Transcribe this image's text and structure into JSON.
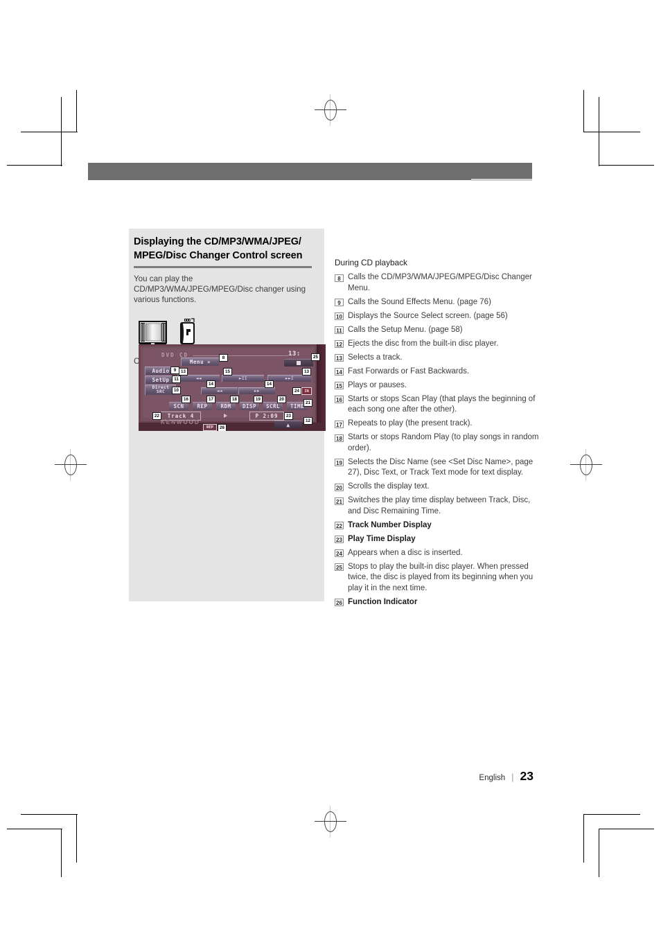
{
  "document": {
    "language": "English",
    "page_number": "23"
  },
  "section": {
    "title": "Displaying the CD/MP3/WMA/JPEG/ MPEG/Disc Changer Control screen",
    "intro": "You can play the CD/MP3/WMA/JPEG/MPEG/Disc changer using various functions.",
    "screen_label": "CD Control screen",
    "icons": [
      {
        "name": "monitor-icon",
        "meaning": "monitor screen"
      },
      {
        "name": "remote-control-icon",
        "meaning": "remote control"
      }
    ]
  },
  "cd_control_screen": {
    "source_label": "DVD CD",
    "clock": "13:",
    "menu_button": "Menu »",
    "left_buttons": [
      "Audio",
      "SetUp",
      "Direct SRC"
    ],
    "transport": {
      "track_prev": "◄◄",
      "play_pause": "►II",
      "track_next": "►►I",
      "fast_back": "◄◄",
      "fast_fwd": "►►"
    },
    "function_buttons": [
      "SCN",
      "REP",
      "RDM",
      "DISP",
      "SCRL",
      "TIME"
    ],
    "track_display": "Track 4",
    "disc_text": "KENWOOD",
    "play_time": "P 2:09",
    "in_badge": "IN",
    "function_indicator": "REP",
    "eject_symbol": "▲",
    "callouts": [
      "8",
      "9",
      "10",
      "11",
      "12",
      "13",
      "13",
      "14",
      "14",
      "15",
      "16",
      "17",
      "18",
      "19",
      "20",
      "21",
      "22",
      "23",
      "24",
      "25",
      "26"
    ]
  },
  "right_column": {
    "heading": "During CD playback",
    "items": [
      {
        "num": "8",
        "text": "Calls the CD/MP3/WMA/JPEG/MPEG/Disc Changer Menu.",
        "bold": false
      },
      {
        "num": "9",
        "text": "Calls the Sound Effects Menu. (page 76)",
        "bold": false
      },
      {
        "num": "10",
        "text": "Displays the Source Select screen. (page 56)",
        "bold": false
      },
      {
        "num": "11",
        "text": "Calls the Setup Menu. (page 58)",
        "bold": false
      },
      {
        "num": "12",
        "text": "Ejects the disc from the built-in disc player.",
        "bold": false
      },
      {
        "num": "13",
        "text": "Selects a track.",
        "bold": false
      },
      {
        "num": "14",
        "text": "Fast Forwards or Fast Backwards.",
        "bold": false
      },
      {
        "num": "15",
        "text": "Plays or pauses.",
        "bold": false
      },
      {
        "num": "16",
        "text": "Starts or stops Scan Play (that plays the beginning of each song one after the other).",
        "bold": false
      },
      {
        "num": "17",
        "text": "Repeats to play (the present track).",
        "bold": false
      },
      {
        "num": "18",
        "text": "Starts or stops Random Play (to play songs in random order).",
        "bold": false
      },
      {
        "num": "19",
        "text": "Selects the Disc Name (see <Set Disc Name>, page 27), Disc Text, or Track Text mode for text display.",
        "bold": false
      },
      {
        "num": "20",
        "text": "Scrolls the display text.",
        "bold": false
      },
      {
        "num": "21",
        "text": "Switches the play time display between Track, Disc, and Disc Remaining Time.",
        "bold": false
      },
      {
        "num": "22",
        "text": "Track Number Display",
        "bold": true
      },
      {
        "num": "23",
        "text": "Play Time Display",
        "bold": true
      },
      {
        "num": "24",
        "text": "Appears when a disc is inserted.",
        "bold": false
      },
      {
        "num": "25",
        "text": "Stops to play the built-in disc player. When pressed twice, the disc is played from its beginning when you play it in the next time.",
        "bold": false
      },
      {
        "num": "26",
        "text": "Function Indicator",
        "bold": true
      }
    ]
  },
  "colors": {
    "header_band": "#6e6e6e",
    "panel_bg": "#e4e4e4",
    "screen_bg": "#7b5565"
  }
}
